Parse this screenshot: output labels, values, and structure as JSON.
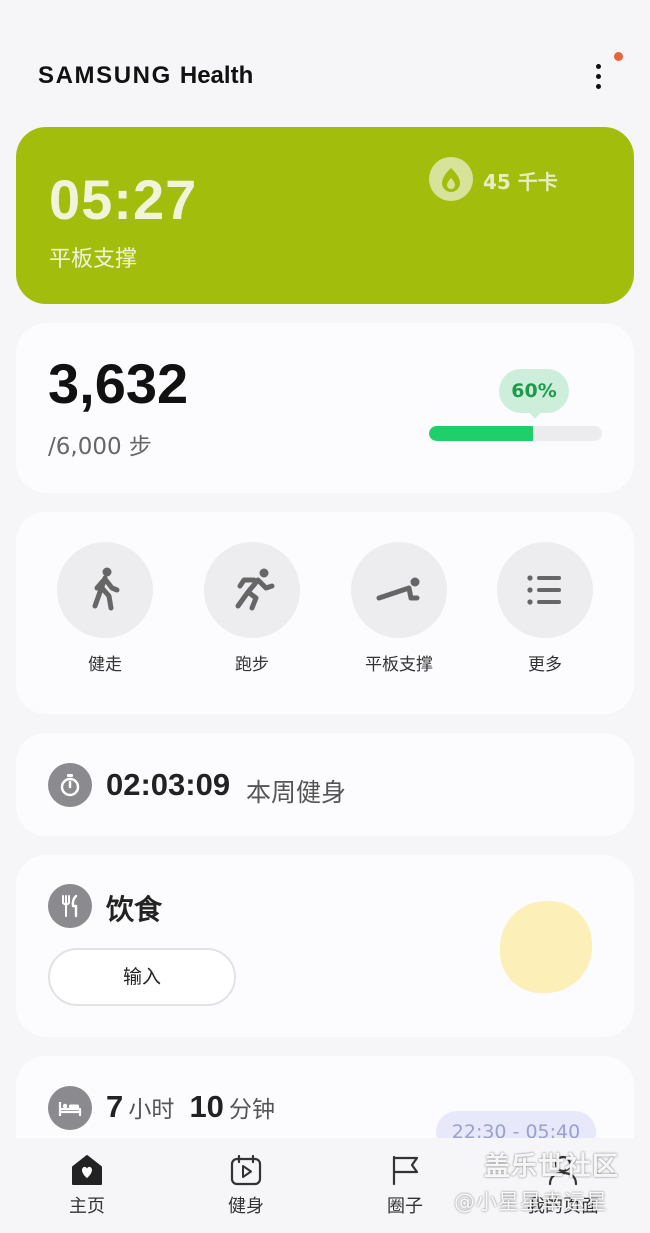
{
  "header": {
    "brand_samsung": "SAMSUNG",
    "brand_health": "Health",
    "more_icon": "more-vert-icon",
    "notification_color": "#e8643a"
  },
  "workout_card": {
    "time": "05:27",
    "name": "平板支撑",
    "calories": "45 千卡",
    "calorie_icon": "flame-icon",
    "background": "#a3bd0d"
  },
  "steps_card": {
    "count": "3,632",
    "goal": "/6,000 步",
    "percent_label": "60%",
    "progress_fraction": 0.6,
    "bar_color": "#1fcf6a"
  },
  "quick_actions": [
    {
      "label": "健走",
      "icon": "walking-icon"
    },
    {
      "label": "跑步",
      "icon": "running-icon"
    },
    {
      "label": "平板支撑",
      "icon": "plank-icon"
    },
    {
      "label": "更多",
      "icon": "list-icon"
    }
  ],
  "weekly_card": {
    "icon": "stopwatch-icon",
    "duration": "02:03:09",
    "label": "本周健身"
  },
  "diet_card": {
    "icon": "cutlery-icon",
    "title": "饮食",
    "input_label": "输入",
    "illustration": "lemon-icon"
  },
  "sleep_card": {
    "icon": "bed-icon",
    "hours": "7",
    "hours_unit": "小时",
    "minutes": "10",
    "minutes_unit": "分钟",
    "range": "22:30 - 05:40"
  },
  "bottom_nav": [
    {
      "label": "主页",
      "icon": "home-heart-icon",
      "active": true
    },
    {
      "label": "健身",
      "icon": "calendar-play-icon",
      "active": false
    },
    {
      "label": "圈子",
      "icon": "flag-icon",
      "active": false
    },
    {
      "label": "我的页面",
      "icon": "person-icon",
      "active": false
    }
  ],
  "watermark": {
    "line1": "盖乐世社区",
    "line2": "@小星星幸运星"
  }
}
